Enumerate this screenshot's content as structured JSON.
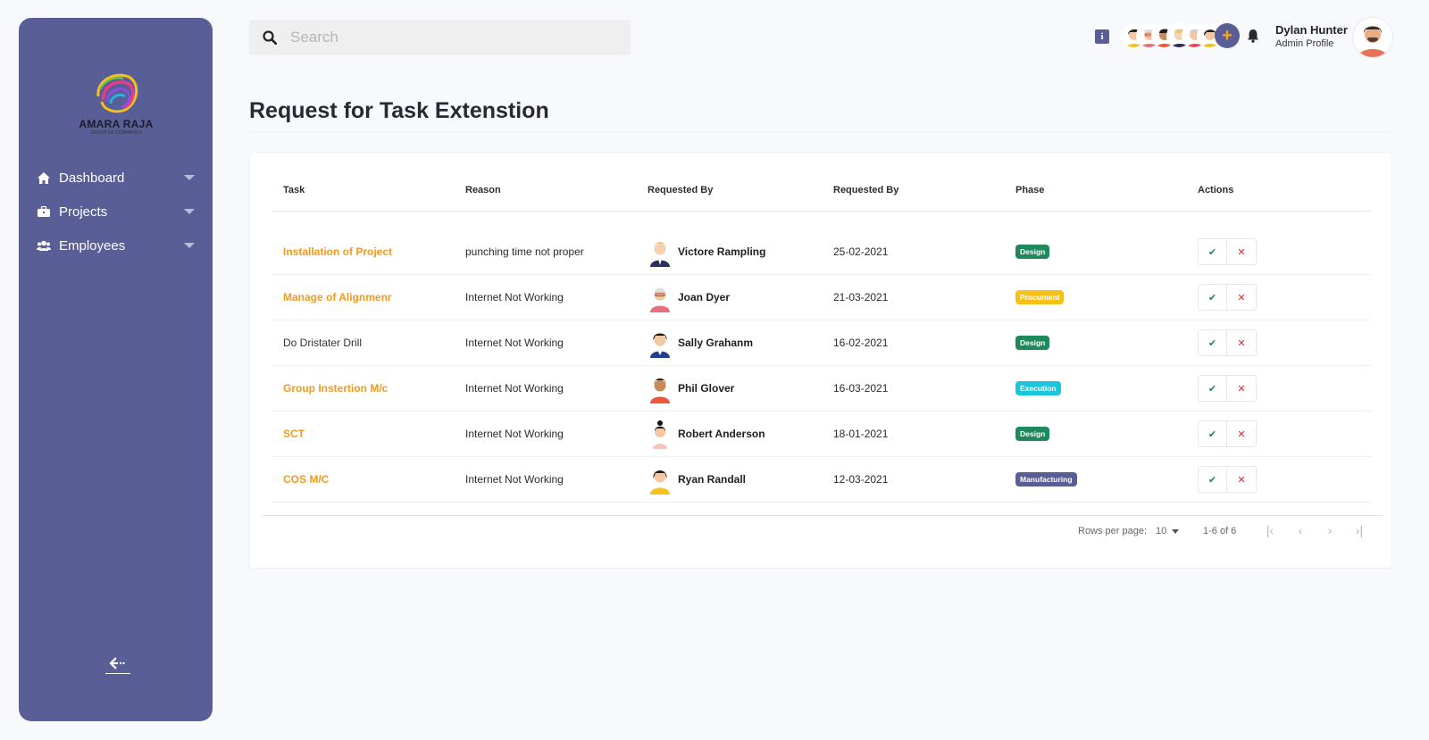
{
  "brand": {
    "name": "AMARA RAJA",
    "tagline": "GROUP OF COMPANIES"
  },
  "sidebar": {
    "items": [
      {
        "label": "Dashboard",
        "icon": "home-icon"
      },
      {
        "label": "Projects",
        "icon": "briefcase-icon"
      },
      {
        "label": "Employees",
        "icon": "users-icon"
      }
    ],
    "collapse_icon": "arrow-left-icon"
  },
  "search": {
    "placeholder": "Search",
    "value": ""
  },
  "header": {
    "user_name": "Dylan Hunter",
    "user_role": "Admin Profile",
    "info_glyph": "i"
  },
  "page": {
    "title": "Request for Task Extenstion"
  },
  "table": {
    "columns": [
      "Task",
      "Reason",
      "Requested By",
      "Requested By",
      "Phase",
      "Actions"
    ],
    "rows": [
      {
        "task": "Installation of Project",
        "task_style": "link",
        "reason": "punching time not proper",
        "person": "Victore Rampling",
        "date": "25-02-2021",
        "phase": "Design",
        "phase_color": "#1e8a5c"
      },
      {
        "task": "Manage of Alignmenr",
        "task_style": "link",
        "reason": "Internet Not Working",
        "person": "Joan Dyer",
        "date": "21-03-2021",
        "phase": "Procument",
        "phase_color": "#f5c21b"
      },
      {
        "task": "Do Dristater Drill",
        "task_style": "plain",
        "reason": "Internet Not Working",
        "person": "Sally Grahanm",
        "date": "16-02-2021",
        "phase": "Design",
        "phase_color": "#1e8a5c"
      },
      {
        "task": "Group Instertion M/c",
        "task_style": "link",
        "reason": "Internet Not Working",
        "person": "Phil Glover",
        "date": "16-03-2021",
        "phase": "Execution",
        "phase_color": "#1ec6dc"
      },
      {
        "task": "SCT",
        "task_style": "link",
        "reason": "Internet Not Working",
        "person": "Robert Anderson",
        "date": "18-01-2021",
        "phase": "Design",
        "phase_color": "#1e8a5c"
      },
      {
        "task": "COS M/C",
        "task_style": "link",
        "reason": "Internet Not Working",
        "person": "Ryan Randall",
        "date": "12-03-2021",
        "phase": "Manufacturing",
        "phase_color": "#5a5e96"
      }
    ],
    "approve_glyph": "✔",
    "reject_glyph": "✕"
  },
  "pagination": {
    "rows_per_page_label": "Rows per page:",
    "rows_per_page_value": "10",
    "range_text": "1-6 of 6"
  },
  "colors": {
    "sidebar": "#5a5e96",
    "accent": "#f29a1f"
  }
}
